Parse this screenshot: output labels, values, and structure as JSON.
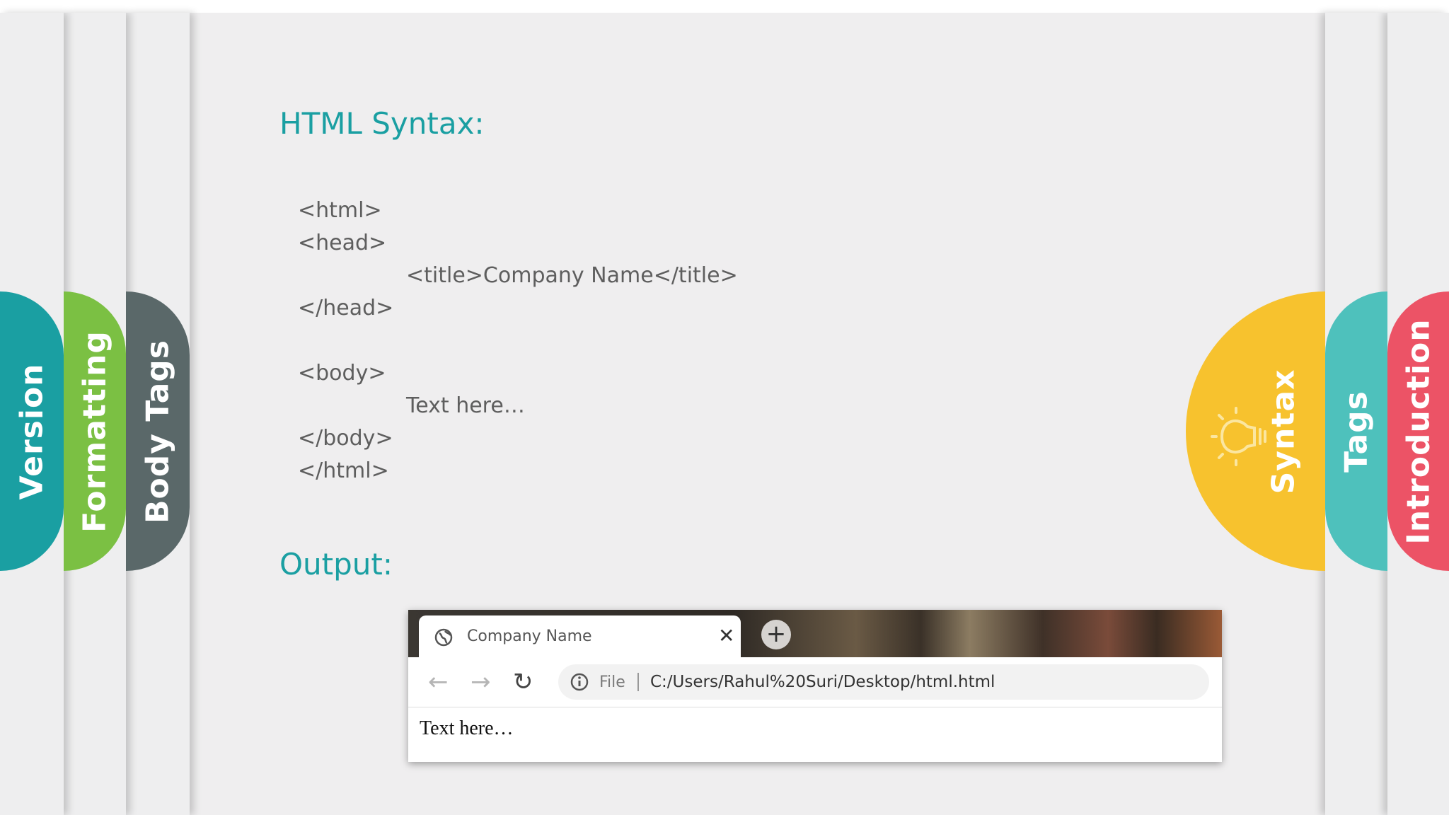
{
  "left_tabs": {
    "version": "Version",
    "formatting": "Formatting",
    "body_tags": "Body Tags"
  },
  "right_tabs": {
    "syntax": "Syntax",
    "tags": "Tags",
    "introduction": "Introduction"
  },
  "icons": {
    "syntax_tab": "lightbulb-icon",
    "browser_tab": "globe-icon",
    "close": "close-icon",
    "new_tab": "plus-icon",
    "back": "arrow-left-icon",
    "forward": "arrow-right-icon",
    "reload": "reload-icon",
    "info": "info-icon"
  },
  "colors": {
    "heading": "#1a9fa2",
    "version_tab": "#1a9fa2",
    "formatting_tab": "#7bc043",
    "body_tags_tab": "#5a6869",
    "syntax_tab": "#f7c22e",
    "tags_tab": "#4ec1bc",
    "introduction_tab": "#ec5366"
  },
  "slide": {
    "syntax_heading": "HTML Syntax:",
    "output_heading": "Output:",
    "code_lines": [
      "<html>",
      "<head>",
      "<title>Company Name</title>",
      "</head>",
      "<body>",
      "Text here…",
      "</body>",
      "</html>"
    ]
  },
  "browser": {
    "tab_title": "Company Name",
    "close_glyph": "✕",
    "new_tab_glyph": "+",
    "back_glyph": "←",
    "forward_glyph": "→",
    "reload_glyph": "↻",
    "file_label": "File",
    "url": "C:/Users/Rahul%20Suri/Desktop/html.html",
    "page_text": "Text here…"
  }
}
